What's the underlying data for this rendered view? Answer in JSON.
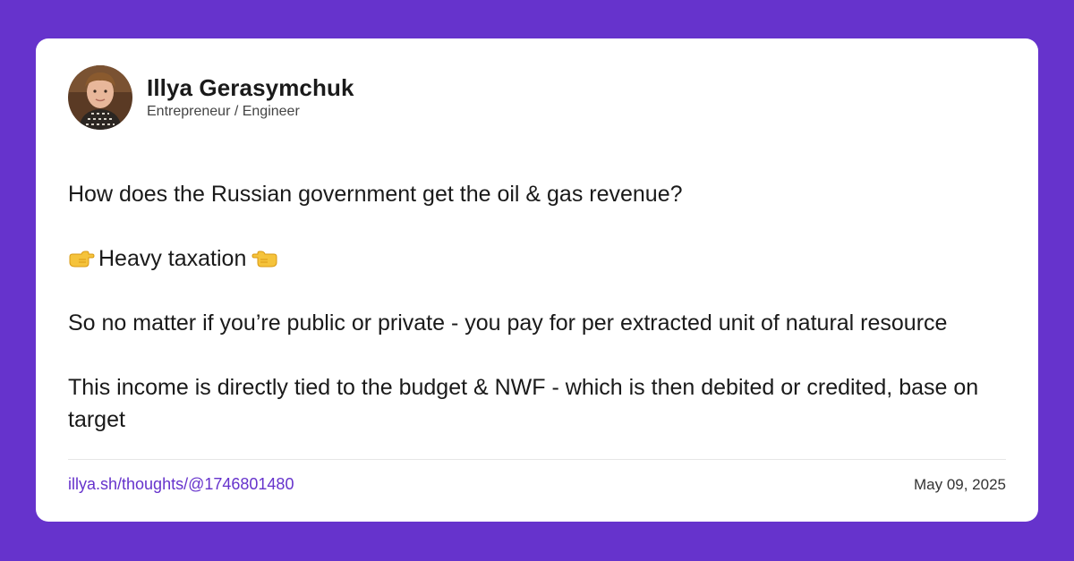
{
  "author": {
    "name": "Illya Gerasymchuk",
    "role": "Entrepreneur / Engineer",
    "avatar_icon": "profile-photo"
  },
  "post": {
    "question": "How does the Russian government get the oil & gas revenue?",
    "highlight": "Heavy taxation",
    "highlight_left_icon": "pointing-right-emoji",
    "highlight_right_icon": "pointing-left-emoji",
    "paragraph_1": "So no matter if you’re public or private - you pay for per extracted unit of natural resource",
    "paragraph_2": "This income is directly tied to the budget & NWF - which is then debited or credited, base on target"
  },
  "footer": {
    "link": "illya.sh/thoughts/@1746801480",
    "date": "May 09, 2025"
  },
  "colors": {
    "background": "#6633cc",
    "card": "#ffffff",
    "link": "#6633cc",
    "text": "#1a1a1a"
  }
}
